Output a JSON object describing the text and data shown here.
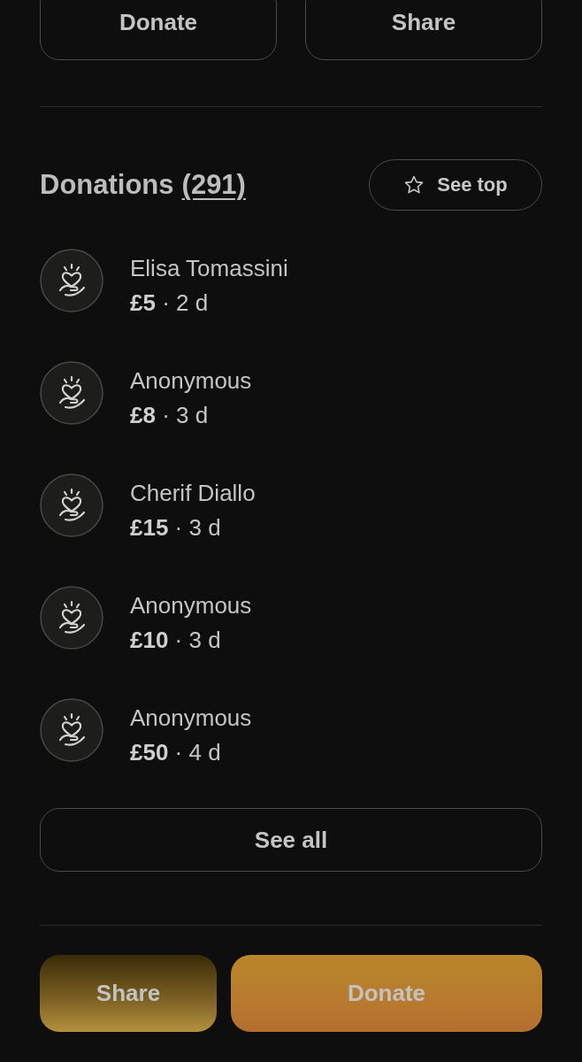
{
  "top_actions": [
    {
      "label": "Donate"
    },
    {
      "label": "Share"
    }
  ],
  "donations": {
    "title": "Donations",
    "count": "(291)",
    "see_top": "See top",
    "items": [
      {
        "name": "Elisa Tomassini",
        "detail": "**£5** · 2 d"
      },
      {
        "name": "Anonymous",
        "detail": "**£8** · 3 d"
      },
      {
        "name": "Cherif Diallo",
        "detail": "**£15** · 3 d"
      },
      {
        "name": "Anonymous",
        "detail": "**£10** · 3 d"
      },
      {
        "name": "Anonymous",
        "detail": "**£50** · 4 d"
      }
    ],
    "see_all": "See all"
  },
  "bottom_actions": [
    {
      "label": "Share",
      "kind": "secondary"
    },
    {
      "label": "Donate",
      "kind": "primary"
    }
  ]
}
